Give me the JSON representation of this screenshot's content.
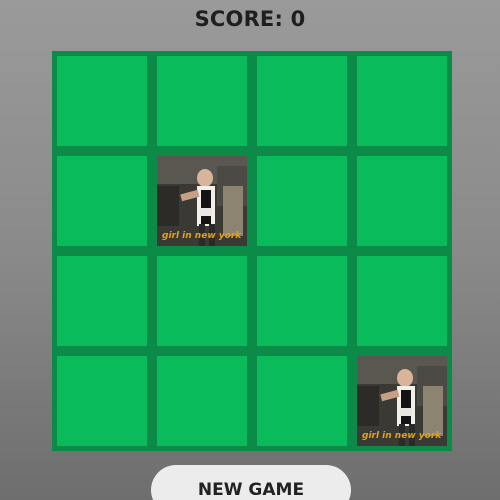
{
  "score_label": "SCORE: 0",
  "new_game_label": "NEW GAME",
  "colors": {
    "board_border": "#0c8a48",
    "tile_hidden": "#09bb5b",
    "caption": "#e2a21a"
  },
  "tiles": [
    {
      "state": "hidden",
      "caption": ""
    },
    {
      "state": "hidden",
      "caption": ""
    },
    {
      "state": "hidden",
      "caption": ""
    },
    {
      "state": "hidden",
      "caption": ""
    },
    {
      "state": "hidden",
      "caption": ""
    },
    {
      "state": "revealed",
      "caption": "girl in new york"
    },
    {
      "state": "hidden",
      "caption": ""
    },
    {
      "state": "hidden",
      "caption": ""
    },
    {
      "state": "hidden",
      "caption": ""
    },
    {
      "state": "hidden",
      "caption": ""
    },
    {
      "state": "hidden",
      "caption": ""
    },
    {
      "state": "hidden",
      "caption": ""
    },
    {
      "state": "hidden",
      "caption": ""
    },
    {
      "state": "hidden",
      "caption": ""
    },
    {
      "state": "hidden",
      "caption": ""
    },
    {
      "state": "revealed",
      "caption": "girl in new york"
    }
  ]
}
